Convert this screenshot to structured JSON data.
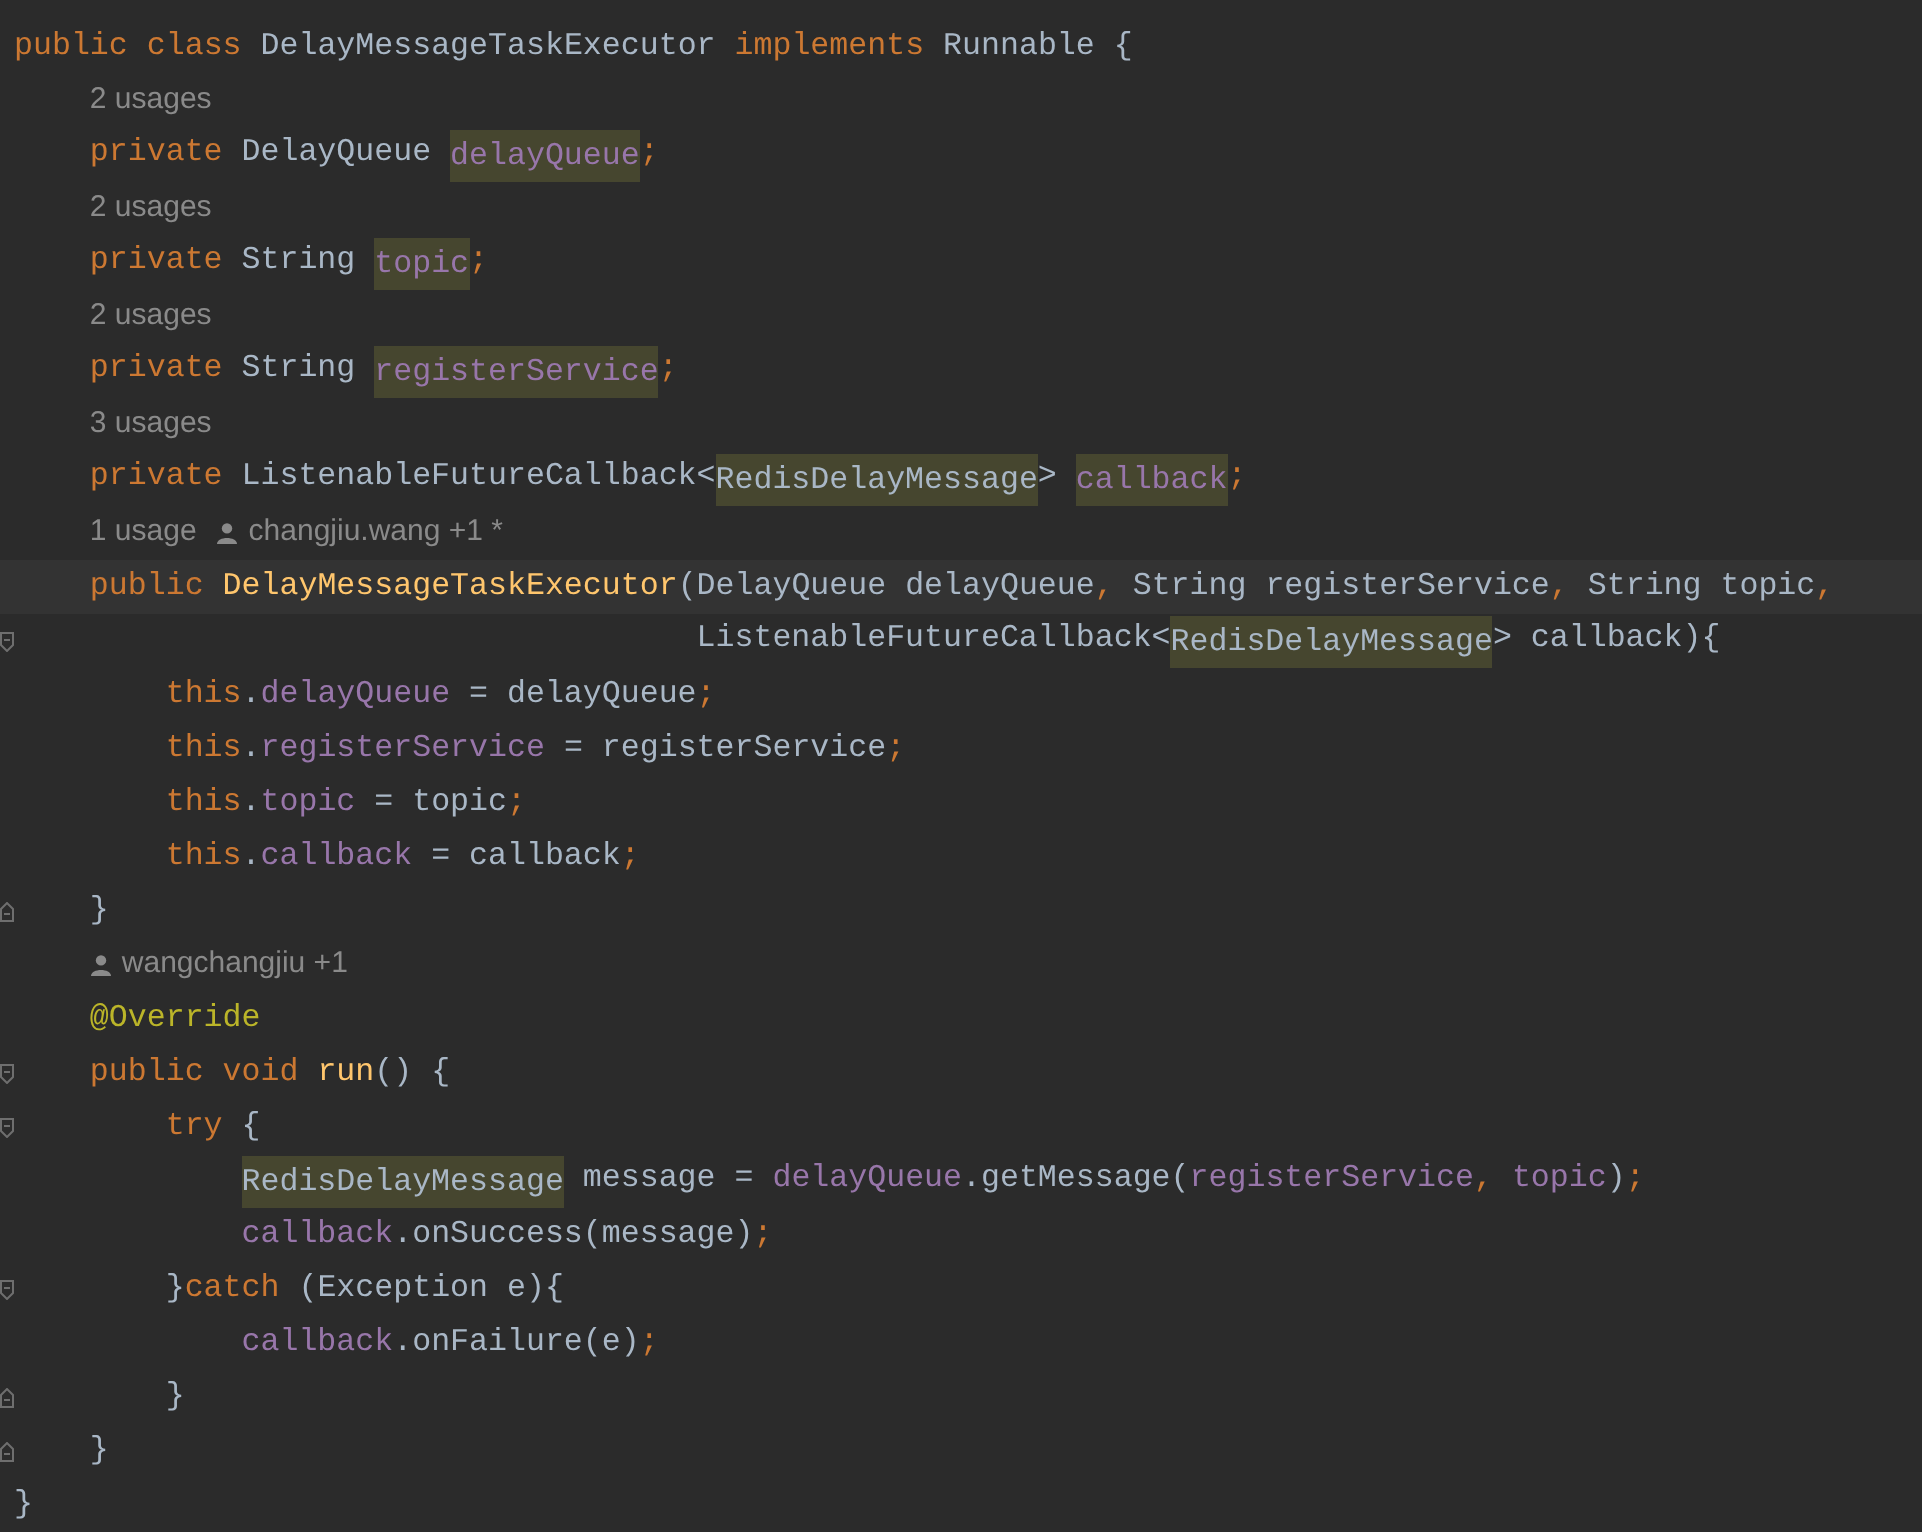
{
  "editor": {
    "lines": [
      {
        "kind": "code",
        "tokens": [
          {
            "text": "public",
            "kind": "kw"
          },
          {
            "text": " class",
            "kind": "kw"
          },
          {
            "text": " DelayMessageTaskExecutor",
            "kind": "text"
          },
          {
            "text": " implements",
            "kind": "kw"
          },
          {
            "text": " Runnable {",
            "kind": "text"
          }
        ]
      },
      {
        "kind": "hint",
        "usages": "2 usages"
      },
      {
        "kind": "code",
        "tokens": [
          {
            "text": "    private",
            "kind": "kw"
          },
          {
            "text": " DelayQueue ",
            "kind": "text"
          },
          {
            "text": "delayQueue",
            "kind": "field-match"
          },
          {
            "text": ";",
            "kind": "punct"
          }
        ]
      },
      {
        "kind": "hint",
        "usages": "2 usages"
      },
      {
        "kind": "code",
        "tokens": [
          {
            "text": "    private",
            "kind": "kw"
          },
          {
            "text": " String ",
            "kind": "text"
          },
          {
            "text": "topic",
            "kind": "field-match"
          },
          {
            "text": ";",
            "kind": "punct"
          }
        ]
      },
      {
        "kind": "hint",
        "usages": "2 usages"
      },
      {
        "kind": "code",
        "tokens": [
          {
            "text": "    private",
            "kind": "kw"
          },
          {
            "text": " String ",
            "kind": "text"
          },
          {
            "text": "registerService",
            "kind": "field-match"
          },
          {
            "text": ";",
            "kind": "punct"
          }
        ]
      },
      {
        "kind": "hint",
        "usages": "3 usages"
      },
      {
        "kind": "code",
        "tokens": [
          {
            "text": "    private",
            "kind": "kw"
          },
          {
            "text": " ListenableFutureCallback<",
            "kind": "text"
          },
          {
            "text": "RedisDelayMessage",
            "kind": "type-match"
          },
          {
            "text": "> ",
            "kind": "text"
          },
          {
            "text": "callback",
            "kind": "field-match"
          },
          {
            "text": ";",
            "kind": "punct"
          }
        ]
      },
      {
        "kind": "hint",
        "usages": "1 usage",
        "author": "changjiu.wang +1 *"
      },
      {
        "kind": "current-code",
        "tokens": [
          {
            "text": "    public",
            "kind": "kw"
          },
          {
            "text": " DelayMessageTaskExecutor",
            "kind": "decl"
          },
          {
            "text": "(DelayQueue delayQueue",
            "kind": "text"
          },
          {
            "text": ",",
            "kind": "punct"
          },
          {
            "text": " String registerService",
            "kind": "text"
          },
          {
            "text": ",",
            "kind": "punct"
          },
          {
            "text": " String topic",
            "kind": "text"
          },
          {
            "text": ",",
            "kind": "punct"
          }
        ]
      },
      {
        "kind": "code",
        "fold_marker": {
          "kind": "start"
        },
        "tokens": [
          {
            "text": "                                    ListenableFutureCallback<",
            "kind": "text"
          },
          {
            "text": "RedisDelayMessage",
            "kind": "type-match"
          },
          {
            "text": "> callback){",
            "kind": "text"
          }
        ]
      },
      {
        "kind": "code",
        "tokens": [
          {
            "text": "        this",
            "kind": "kw"
          },
          {
            "text": ".",
            "kind": "text"
          },
          {
            "text": "delayQueue",
            "kind": "field"
          },
          {
            "text": " = delayQueue",
            "kind": "text"
          },
          {
            "text": ";",
            "kind": "punct"
          }
        ]
      },
      {
        "kind": "code",
        "tokens": [
          {
            "text": "        this",
            "kind": "kw"
          },
          {
            "text": ".",
            "kind": "text"
          },
          {
            "text": "registerService",
            "kind": "field"
          },
          {
            "text": " = registerService",
            "kind": "text"
          },
          {
            "text": ";",
            "kind": "punct"
          }
        ]
      },
      {
        "kind": "code",
        "tokens": [
          {
            "text": "        this",
            "kind": "kw"
          },
          {
            "text": ".",
            "kind": "text"
          },
          {
            "text": "topic",
            "kind": "field"
          },
          {
            "text": " = topic",
            "kind": "text"
          },
          {
            "text": ";",
            "kind": "punct"
          }
        ]
      },
      {
        "kind": "code",
        "tokens": [
          {
            "text": "        this",
            "kind": "kw"
          },
          {
            "text": ".",
            "kind": "text"
          },
          {
            "text": "callback",
            "kind": "field"
          },
          {
            "text": " = callback",
            "kind": "text"
          },
          {
            "text": ";",
            "kind": "punct"
          }
        ]
      },
      {
        "kind": "code",
        "fold_marker": {
          "kind": "end"
        },
        "tokens": [
          {
            "text": "    }",
            "kind": "text"
          }
        ]
      },
      {
        "kind": "hint",
        "author": "wangchangjiu +1"
      },
      {
        "kind": "code",
        "tokens": [
          {
            "text": "    @Override",
            "kind": "annot"
          }
        ]
      },
      {
        "kind": "code",
        "fold_marker": {
          "kind": "start"
        },
        "tokens": [
          {
            "text": "    public",
            "kind": "kw"
          },
          {
            "text": " void",
            "kind": "kw"
          },
          {
            "text": " run",
            "kind": "decl"
          },
          {
            "text": "() {",
            "kind": "text"
          }
        ]
      },
      {
        "kind": "code",
        "fold_marker": {
          "kind": "start"
        },
        "tokens": [
          {
            "text": "        try",
            "kind": "kw"
          },
          {
            "text": " {",
            "kind": "text"
          }
        ]
      },
      {
        "kind": "code",
        "tokens": [
          {
            "text": "            RedisDelayMessage",
            "kind": "type-match"
          },
          {
            "text": " message = ",
            "kind": "text"
          },
          {
            "text": "delayQueue",
            "kind": "field"
          },
          {
            "text": ".getMessage(",
            "kind": "text"
          },
          {
            "text": "registerService",
            "kind": "field"
          },
          {
            "text": ",",
            "kind": "punct"
          },
          {
            "text": " topic",
            "kind": "field"
          },
          {
            "text": ")",
            "kind": "text"
          },
          {
            "text": ";",
            "kind": "punct"
          }
        ]
      },
      {
        "kind": "code",
        "tokens": [
          {
            "text": "            callback",
            "kind": "field"
          },
          {
            "text": ".onSuccess(message)",
            "kind": "text"
          },
          {
            "text": ";",
            "kind": "punct"
          }
        ]
      },
      {
        "kind": "code",
        "fold_marker": {
          "kind": "start"
        },
        "tokens": [
          {
            "text": "        }",
            "kind": "text"
          },
          {
            "text": "catch",
            "kind": "kw"
          },
          {
            "text": " (Exception e){",
            "kind": "text"
          }
        ]
      },
      {
        "kind": "code",
        "tokens": [
          {
            "text": "            callback",
            "kind": "field"
          },
          {
            "text": ".onFailure(e)",
            "kind": "text"
          },
          {
            "text": ";",
            "kind": "punct"
          }
        ]
      },
      {
        "kind": "code",
        "fold_marker": {
          "kind": "end"
        },
        "tokens": [
          {
            "text": "        }",
            "kind": "text"
          }
        ]
      },
      {
        "kind": "code",
        "fold_marker": {
          "kind": "end"
        },
        "tokens": [
          {
            "text": "    }",
            "kind": "text"
          }
        ]
      },
      {
        "kind": "code",
        "tokens": [
          {
            "text": "}",
            "kind": "text"
          }
        ]
      }
    ]
  }
}
